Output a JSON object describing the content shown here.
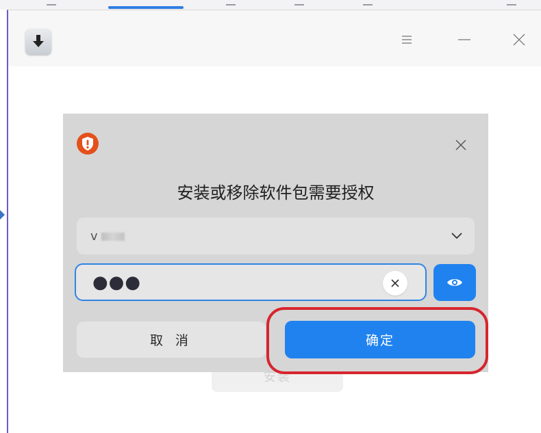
{
  "window": {
    "icon": "download-arrow-icon",
    "controls": [
      "menu-icon",
      "minimize-icon",
      "close-icon"
    ]
  },
  "content": {
    "install_label": "安装"
  },
  "dialog": {
    "icon": "shield-alert-icon",
    "title": "安装或移除软件包需要授权",
    "user_value": "v",
    "password_masked": "●●●",
    "cancel_label": "取 消",
    "confirm_label": "确定",
    "colors": {
      "accent": "#1f82ef",
      "warning": "#e4501c",
      "highlight": "#d6262e"
    }
  }
}
